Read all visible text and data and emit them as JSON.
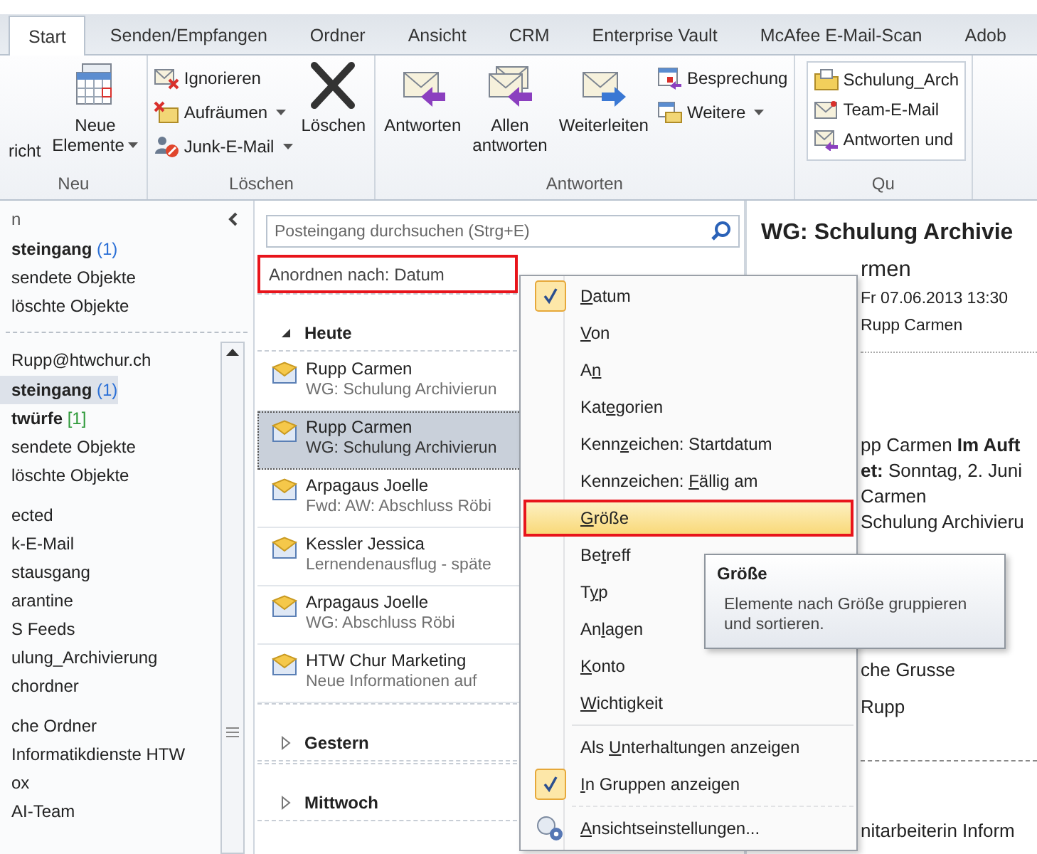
{
  "tabs": [
    {
      "label": "Start",
      "selected": true
    },
    {
      "label": "Senden/Empfangen",
      "selected": false
    },
    {
      "label": "Ordner",
      "selected": false
    },
    {
      "label": "Ansicht",
      "selected": false
    },
    {
      "label": "CRM",
      "selected": false
    },
    {
      "label": "Enterprise Vault",
      "selected": false
    },
    {
      "label": "McAfee E-Mail-Scan",
      "selected": false
    },
    {
      "label": "Adob",
      "selected": false
    }
  ],
  "ribbon": {
    "groups": [
      {
        "label": "Neu",
        "items": [
          {
            "kind": "large",
            "label": "richt",
            "dropdown": false
          },
          {
            "kind": "large",
            "label": "Neue\nElemente",
            "dropdown": true
          }
        ]
      },
      {
        "label": "Löschen",
        "items": [
          {
            "kind": "stack",
            "buttons": [
              {
                "label": "Ignorieren",
                "dropdown": false
              },
              {
                "label": "Aufräumen",
                "dropdown": true
              },
              {
                "label": "Junk-E-Mail",
                "dropdown": true
              }
            ]
          },
          {
            "kind": "large",
            "label": "Löschen",
            "dropdown": false
          }
        ]
      },
      {
        "label": "Antworten",
        "items": [
          {
            "kind": "large",
            "label": "Antworten",
            "dropdown": false
          },
          {
            "kind": "large",
            "label": "Allen\nantworten",
            "dropdown": false
          },
          {
            "kind": "large",
            "label": "Weiterleiten",
            "dropdown": false
          },
          {
            "kind": "stack",
            "buttons": [
              {
                "label": "Besprechung",
                "dropdown": false
              },
              {
                "label": "Weitere",
                "dropdown": true
              }
            ]
          }
        ]
      },
      {
        "label": "Qu",
        "items": [
          {
            "kind": "gallery",
            "buttons": [
              {
                "label": "Schulung_Arch",
                "dropdown": false
              },
              {
                "label": "Team-E-Mail",
                "dropdown": false
              },
              {
                "label": "Antworten und",
                "dropdown": false
              }
            ]
          }
        ]
      }
    ]
  },
  "navigation": {
    "favorites": {
      "title": "n",
      "folders": [
        {
          "label": "steingang",
          "count": "(1)",
          "color": "#2a6fd6",
          "bold": true,
          "selected": false
        },
        {
          "label": "sendete Objekte",
          "bold": false,
          "selected": false
        },
        {
          "label": "löschte Objekte",
          "bold": false,
          "selected": false
        }
      ]
    },
    "account": {
      "name": "Rupp@htwchur.ch",
      "folder_groups": [
        [
          {
            "label": "steingang",
            "count": "(1)",
            "color": "#2a6fd6",
            "bold": true,
            "selected": true
          },
          {
            "label": "twürfe",
            "count": "[1]",
            "color": "#2e9a3a",
            "bold": true,
            "selected": false
          },
          {
            "label": "sendete Objekte",
            "bold": false,
            "selected": false
          },
          {
            "label": "löschte Objekte",
            "bold": false,
            "selected": false
          }
        ],
        [
          {
            "label": "ected",
            "bold": false,
            "selected": false
          },
          {
            "label": "k-E-Mail",
            "bold": false,
            "selected": false
          },
          {
            "label": "stausgang",
            "bold": false,
            "selected": false
          },
          {
            "label": "arantine",
            "bold": false,
            "selected": false
          },
          {
            "label": "S Feeds",
            "bold": false,
            "selected": false
          },
          {
            "label": "ulung_Archivierung",
            "bold": false,
            "selected": false
          },
          {
            "label": "chordner",
            "bold": false,
            "selected": false
          }
        ],
        [
          {
            "label": "che Ordner",
            "bold": false,
            "selected": false
          },
          {
            "label": "Informatikdienste HTW",
            "bold": false,
            "selected": false
          },
          {
            "label": "ox",
            "bold": false,
            "selected": false
          },
          {
            "label": "AI-Team",
            "bold": false,
            "selected": false
          }
        ]
      ]
    }
  },
  "message_list": {
    "search": {
      "placeholder": "Posteingang durchsuchen (Strg+E)"
    },
    "sort": {
      "label": "Anordnen nach: Datum",
      "highlighted": true
    },
    "groups": [
      {
        "label": "Heute",
        "expanded": true,
        "messages": [
          {
            "sender": "Rupp Carmen",
            "subject": "WG: Schulung Archivierun",
            "selected": false
          },
          {
            "sender": "Rupp Carmen",
            "subject": "WG: Schulung Archivierun",
            "selected": true
          },
          {
            "sender": "Arpagaus Joelle",
            "subject": "Fwd: AW: Abschluss Röbi",
            "selected": false
          },
          {
            "sender": "Kessler Jessica",
            "subject": "Lernendenausflug - späte",
            "selected": false
          },
          {
            "sender": "Arpagaus Joelle",
            "subject": "WG: Abschluss Röbi",
            "selected": false
          },
          {
            "sender": "HTW Chur Marketing",
            "subject": "Neue Informationen auf",
            "selected": false
          }
        ]
      },
      {
        "label": "Gestern",
        "expanded": false
      },
      {
        "label": "Mittwoch",
        "expanded": false
      }
    ]
  },
  "reading_pane": {
    "title": "WG: Schulung Archivie",
    "blocks": [
      {
        "lines": [
          {
            "kind": "name",
            "text": "rmen"
          },
          {
            "kind": "meta",
            "text": "Fr 07.06.2013 13:30"
          },
          {
            "kind": "meta",
            "text": "Rupp Carmen"
          }
        ]
      },
      {
        "lines": [
          {
            "kind": "body",
            "text": "pp Carmen **Im Auft**"
          },
          {
            "kind": "body",
            "text": "**et:** Sonntag, 2. Juni"
          },
          {
            "kind": "body",
            "text": "Carmen"
          },
          {
            "kind": "body",
            "text": "Schulung Archivieru"
          }
        ]
      },
      {
        "lines": [
          {
            "kind": "body",
            "text": "che Grusse"
          }
        ]
      },
      {
        "lines": [
          {
            "kind": "body",
            "text": "Rupp"
          }
        ]
      },
      {
        "lines": [
          {
            "kind": "body",
            "text": "nitarbeiterin Inform"
          }
        ]
      }
    ]
  },
  "sort_menu": {
    "sections": [
      {
        "items": [
          {
            "kind": "option",
            "key": "D",
            "after": "atum",
            "checked": true,
            "highlighted": false
          },
          {
            "kind": "option",
            "key": "V",
            "after": "on",
            "checked": false,
            "highlighted": false
          },
          {
            "kind": "option",
            "before": "A",
            "key": "n",
            "checked": false,
            "highlighted": false
          },
          {
            "kind": "option",
            "before": "Kat",
            "key": "e",
            "after": "gorien",
            "checked": false,
            "highlighted": false
          },
          {
            "kind": "option",
            "before": "Kenn",
            "key": "z",
            "after": "eichen: Startdatum",
            "checked": false,
            "highlighted": false
          },
          {
            "kind": "option",
            "before": "Kennzeichen: ",
            "key": "F",
            "after": "ällig am",
            "checked": false,
            "highlighted": false
          },
          {
            "kind": "option",
            "key": "G",
            "after": "röße",
            "checked": false,
            "highlighted": true
          },
          {
            "kind": "option",
            "before": "Be",
            "key": "t",
            "after": "reff",
            "checked": false,
            "highlighted": false
          },
          {
            "kind": "option",
            "before": "T",
            "key": "y",
            "after": "p",
            "checked": false,
            "highlighted": false
          },
          {
            "kind": "option",
            "before": "An",
            "key": "l",
            "after": "agen",
            "checked": false,
            "highlighted": false
          },
          {
            "kind": "option",
            "key": "K",
            "after": "onto",
            "checked": false,
            "highlighted": false
          },
          {
            "kind": "option",
            "key": "W",
            "after": "ichtigkeit",
            "checked": false,
            "highlighted": false
          }
        ]
      },
      {
        "items": [
          {
            "kind": "toggle",
            "before": "Als ",
            "key": "U",
            "after": "nterhaltungen anzeigen",
            "checked": false,
            "highlighted": false
          },
          {
            "kind": "toggle",
            "key": "I",
            "after": "n Gruppen anzeigen",
            "checked": true,
            "highlighted": false
          }
        ]
      },
      {
        "items": [
          {
            "kind": "command",
            "key": "A",
            "after": "nsichtseinstellungen...",
            "highlighted": false
          }
        ]
      }
    ]
  },
  "tooltip": {
    "title": "Größe",
    "text": "Elemente nach Größe gruppieren und sortieren."
  }
}
